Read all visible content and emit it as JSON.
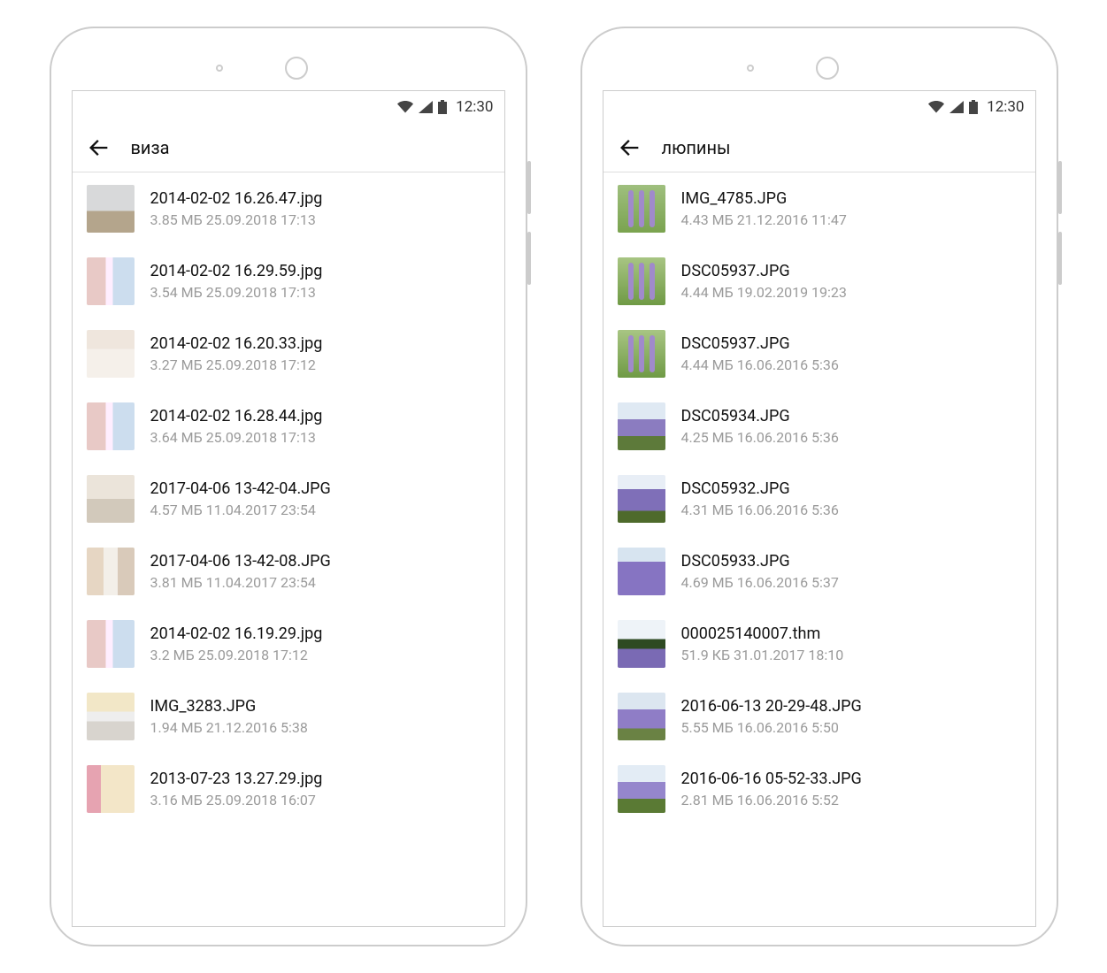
{
  "status": {
    "time": "12:30"
  },
  "phones": [
    {
      "title": "виза",
      "files": [
        {
          "name": "2014-02-02 16.26.47.jpg",
          "meta": "3.85 МБ 25.09.2018 17:13",
          "thumb": "thumb-doc1"
        },
        {
          "name": "2014-02-02 16.29.59.jpg",
          "meta": "3.54 МБ 25.09.2018 17:13",
          "thumb": "thumb-doc2"
        },
        {
          "name": "2014-02-02 16.20.33.jpg",
          "meta": "3.27 МБ 25.09.2018 17:12",
          "thumb": "thumb-doc3"
        },
        {
          "name": "2014-02-02 16.28.44.jpg",
          "meta": "3.64 МБ 25.09.2018 17:13",
          "thumb": "thumb-doc2"
        },
        {
          "name": "2017-04-06 13-42-04.JPG",
          "meta": "4.57 МБ 11.04.2017 23:54",
          "thumb": "thumb-doc4"
        },
        {
          "name": "2017-04-06 13-42-08.JPG",
          "meta": "3.81 МБ 11.04.2017 23:54",
          "thumb": "thumb-doc5"
        },
        {
          "name": "2014-02-02 16.19.29.jpg",
          "meta": "3.2 МБ 25.09.2018 17:12",
          "thumb": "thumb-doc2"
        },
        {
          "name": "IMG_3283.JPG",
          "meta": "1.94 МБ 21.12.2016 5:38",
          "thumb": "thumb-doc6"
        },
        {
          "name": "2013-07-23 13.27.29.jpg",
          "meta": "3.16 МБ 25.09.2018 16:07",
          "thumb": "thumb-doc7"
        }
      ]
    },
    {
      "title": "люпины",
      "files": [
        {
          "name": "IMG_4785.JPG",
          "meta": "4.43 МБ 21.12.2016 11:47",
          "thumb": "thumb-lup1"
        },
        {
          "name": "DSC05937.JPG",
          "meta": "4.44 МБ 19.02.2019 19:23",
          "thumb": "thumb-lup2"
        },
        {
          "name": "DSC05937.JPG",
          "meta": "4.44 МБ 16.06.2016 5:36",
          "thumb": "thumb-lup3"
        },
        {
          "name": "DSC05934.JPG",
          "meta": "4.25 МБ 16.06.2016 5:36",
          "thumb": "thumb-field1"
        },
        {
          "name": "DSC05932.JPG",
          "meta": "4.31 МБ 16.06.2016 5:36",
          "thumb": "thumb-field2"
        },
        {
          "name": "DSC05933.JPG",
          "meta": "4.69 МБ 16.06.2016 5:37",
          "thumb": "thumb-field3"
        },
        {
          "name": "000025140007.thm",
          "meta": "51.9 КБ 31.01.2017 18:10",
          "thumb": "thumb-land1"
        },
        {
          "name": "2016-06-13 20-29-48.JPG",
          "meta": "5.55 МБ 16.06.2016 5:50",
          "thumb": "thumb-land2"
        },
        {
          "name": "2016-06-16 05-52-33.JPG",
          "meta": "2.81 МБ 16.06.2016 5:52",
          "thumb": "thumb-land3"
        }
      ]
    }
  ]
}
